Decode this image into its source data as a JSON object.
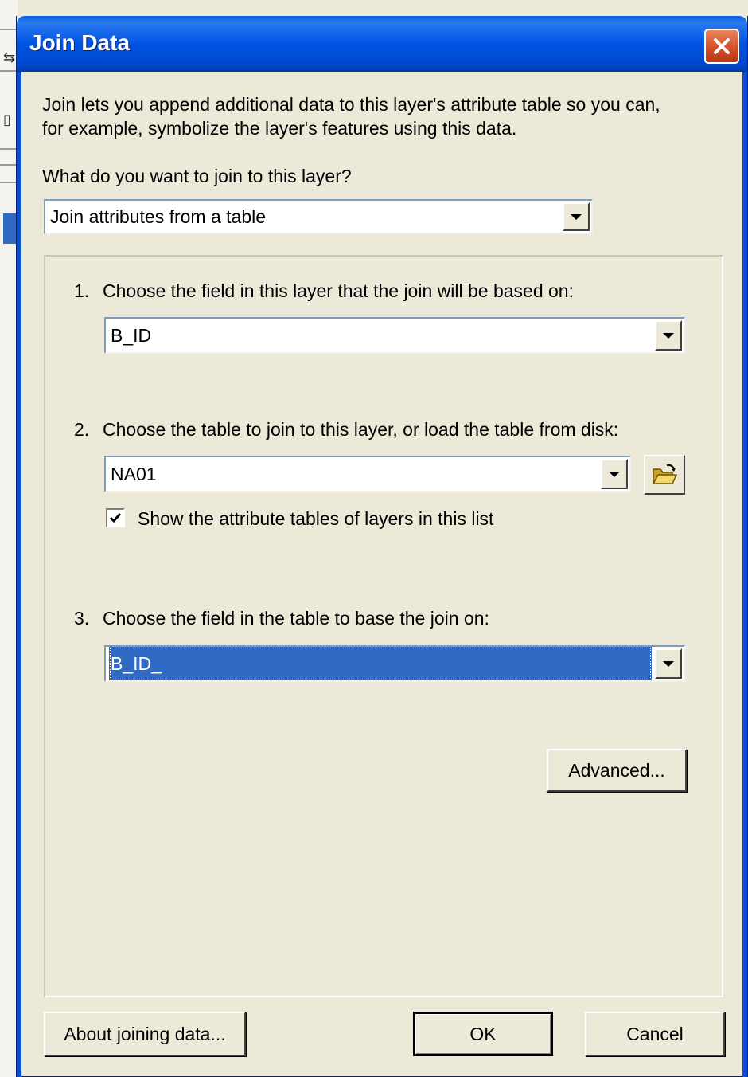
{
  "window": {
    "title": "Join Data"
  },
  "intro": {
    "line1": "Join lets you append additional data to this layer's attribute table so you can,",
    "line2": "for example, symbolize the layer's features using this data."
  },
  "join_type": {
    "question": "What do you want to join to this layer?",
    "selected": "Join attributes from a table"
  },
  "steps": [
    {
      "number": "1.",
      "label": "Choose the field in this layer that the join will be based on:",
      "selected": "B_ID"
    },
    {
      "number": "2.",
      "label": "Choose the table to join to this layer, or load the table from disk:",
      "selected": "NA01"
    },
    {
      "number": "3.",
      "label": "Choose the field in the table to base the join on:",
      "selected": "B_ID_"
    }
  ],
  "show_attribute_tables": {
    "label": "Show the attribute tables of layers in this list",
    "checked": true
  },
  "buttons": {
    "advanced": "Advanced...",
    "about": "About joining data...",
    "ok": "OK",
    "cancel": "Cancel"
  },
  "icons": {
    "close": "close-icon",
    "dropdown": "chevron-down-icon",
    "open_folder": "open-folder-icon",
    "checkmark": "checkmark-icon"
  },
  "colors": {
    "titlebar": "#0054e3",
    "dialog_bg": "#ece9d8",
    "selection": "#316ac5",
    "close_button": "#d04c26"
  }
}
